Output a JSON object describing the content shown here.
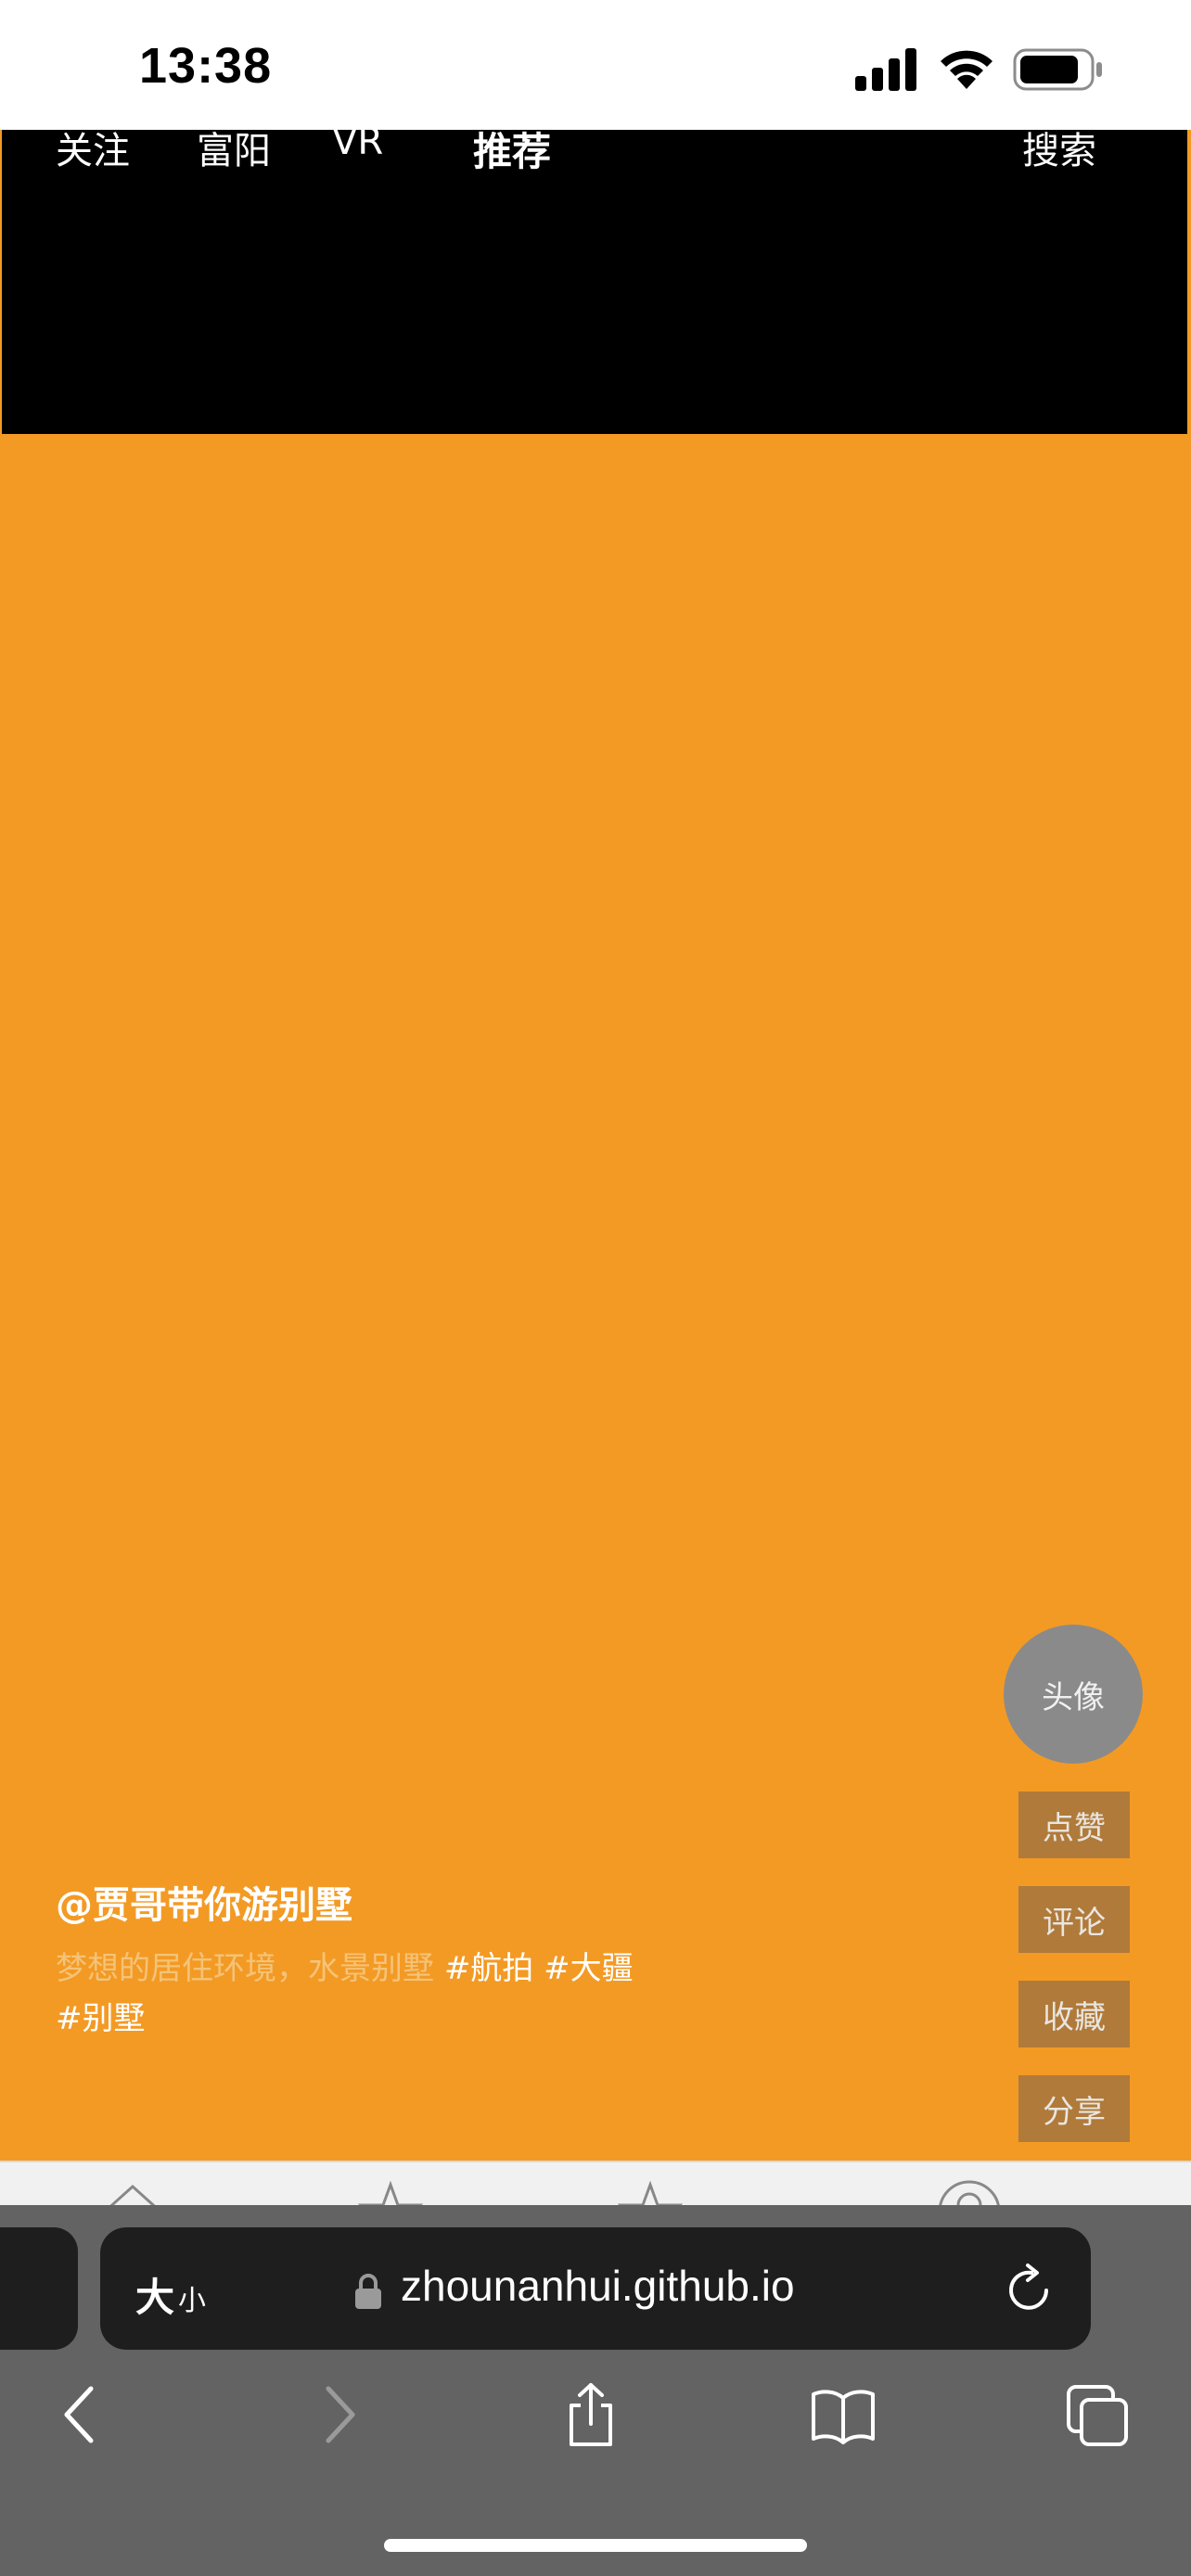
{
  "status_bar": {
    "time": "13:38",
    "icons": [
      "signal-icon",
      "wifi-icon",
      "battery-icon"
    ]
  },
  "top_nav": {
    "items": [
      "关注",
      "富阳",
      "VR",
      "推荐"
    ],
    "active": "推荐",
    "search_label": "搜索"
  },
  "side_actions": {
    "avatar_label": "头像",
    "like_label": "点赞",
    "comment_label": "评论",
    "favorite_label": "收藏",
    "share_label": "分享"
  },
  "post": {
    "author": "@贾哥带你游别墅",
    "description": "梦想的居住环境，水景别墅",
    "tags": [
      "#航拍",
      "#大疆",
      "#别墅"
    ]
  },
  "safari": {
    "aa_big": "大",
    "aa_small": "小",
    "url": "zhounanhui.github.io",
    "icons": [
      "lock-icon",
      "reload-icon",
      "back-icon",
      "forward-icon",
      "share-icon",
      "bookmarks-icon",
      "tabs-icon"
    ]
  },
  "colors": {
    "page_background": "#f39a24",
    "video_background": "#000000",
    "avatar": "#8a8a8a",
    "action_button": "#b07a3a",
    "safari_toolbar": "#636363"
  }
}
